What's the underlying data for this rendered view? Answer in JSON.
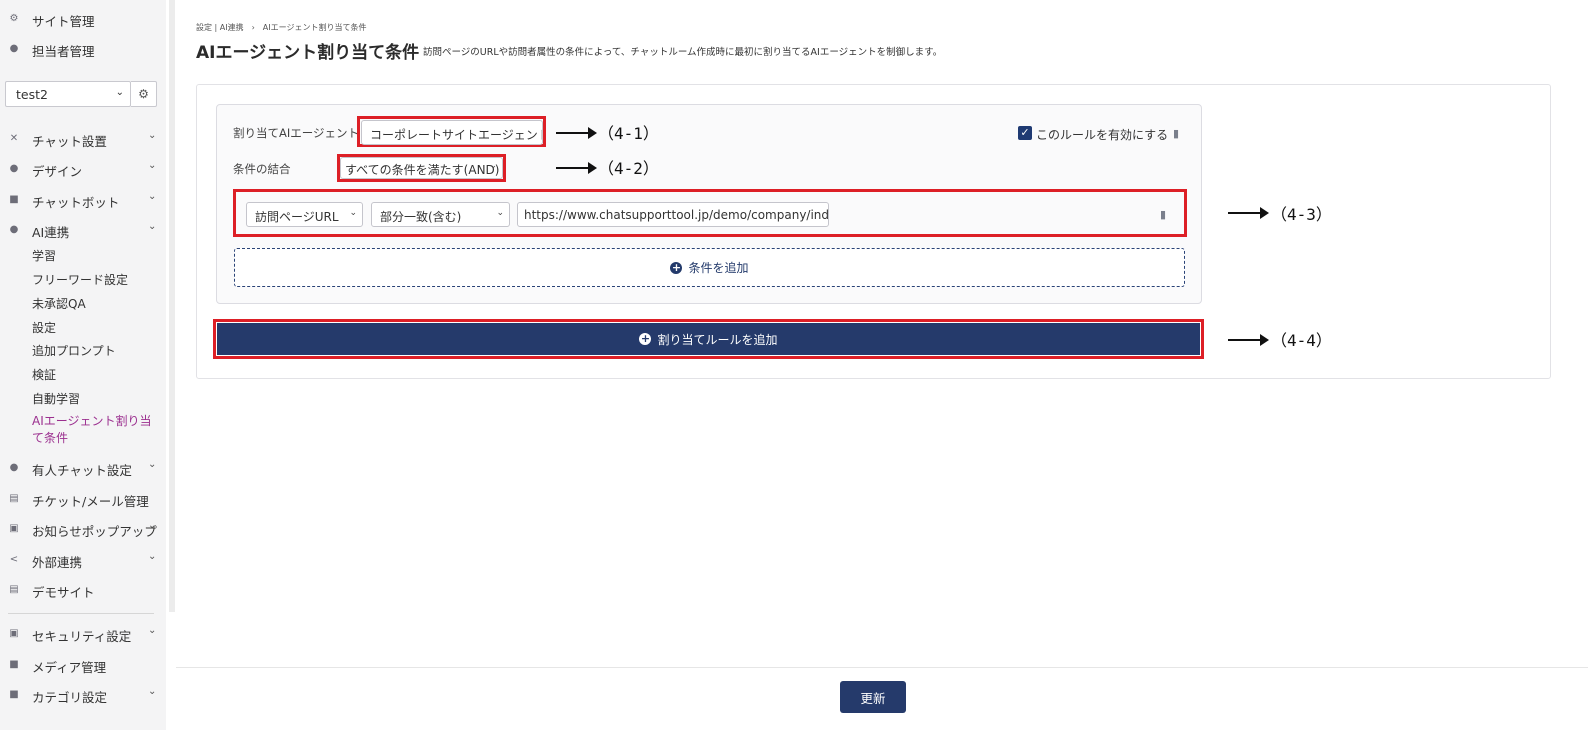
{
  "sidebar": {
    "top_items": [
      {
        "label": "サイト管理",
        "icon": "gear-icon"
      },
      {
        "label": "担当者管理",
        "icon": "users-icon"
      }
    ],
    "site_select_value": "test2",
    "items": [
      {
        "label": "チャット設置",
        "icon": "tools-icon",
        "expandable": true
      },
      {
        "label": "デザイン",
        "icon": "palette-icon",
        "expandable": true
      },
      {
        "label": "チャットボット",
        "icon": "chat-icon",
        "expandable": true
      },
      {
        "label": "AI連携",
        "icon": "bulb-icon",
        "expandable": true
      }
    ],
    "ai_sub_items": [
      "学習",
      "フリーワード設定",
      "未承認QA",
      "設定",
      "追加プロンプト",
      "検証",
      "自動学習",
      "AIエージェント割り当て条件"
    ],
    "items_after": [
      {
        "label": "有人チャット設定",
        "icon": "headset-icon",
        "expandable": true
      },
      {
        "label": "チケット/メール管理",
        "icon": "ticket-icon",
        "expandable": false
      },
      {
        "label": "お知らせポップアップ",
        "icon": "popup-icon",
        "expandable": true
      },
      {
        "label": "外部連携",
        "icon": "share-icon",
        "expandable": true
      },
      {
        "label": "デモサイト",
        "icon": "window-icon",
        "expandable": false
      }
    ],
    "bottom_items": [
      {
        "label": "セキュリティ設定",
        "icon": "lock-icon",
        "expandable": true
      },
      {
        "label": "メディア管理",
        "icon": "image-icon",
        "expandable": false
      },
      {
        "label": "カテゴリ設定",
        "icon": "folder-icon",
        "expandable": true
      }
    ]
  },
  "header": {
    "breadcrumb": "設定 | AI連携　›　AIエージェント割り当て条件",
    "title": "AIエージェント割り当て条件",
    "description": "訪問ページのURLや訪問者属性の条件によって、チャットルーム作成時に最初に割り当てるAIエージェントを制御します。"
  },
  "rule": {
    "agent_label": "割り当てAIエージェント",
    "agent_value": "コーポレートサイトエージェント",
    "combine_label": "条件の結合",
    "combine_value": "すべての条件を満たす(AND)",
    "enable_label": "このルールを有効にする",
    "enabled": true,
    "condition": {
      "type": "訪問ページURL",
      "match": "部分一致(含む)",
      "value": "https://www.chatsupporttool.jp/demo/company/inde"
    },
    "add_condition_label": "条件を追加"
  },
  "add_rule_label": "割り当てルールを追加",
  "update_label": "更新",
  "annotations": [
    "（4-1）",
    "（4-2）",
    "（4-3）",
    "（4-4）"
  ],
  "colors": {
    "accent": "#253a6b",
    "highlight": "#dd1f26",
    "active_nav": "#9b2f8f"
  }
}
